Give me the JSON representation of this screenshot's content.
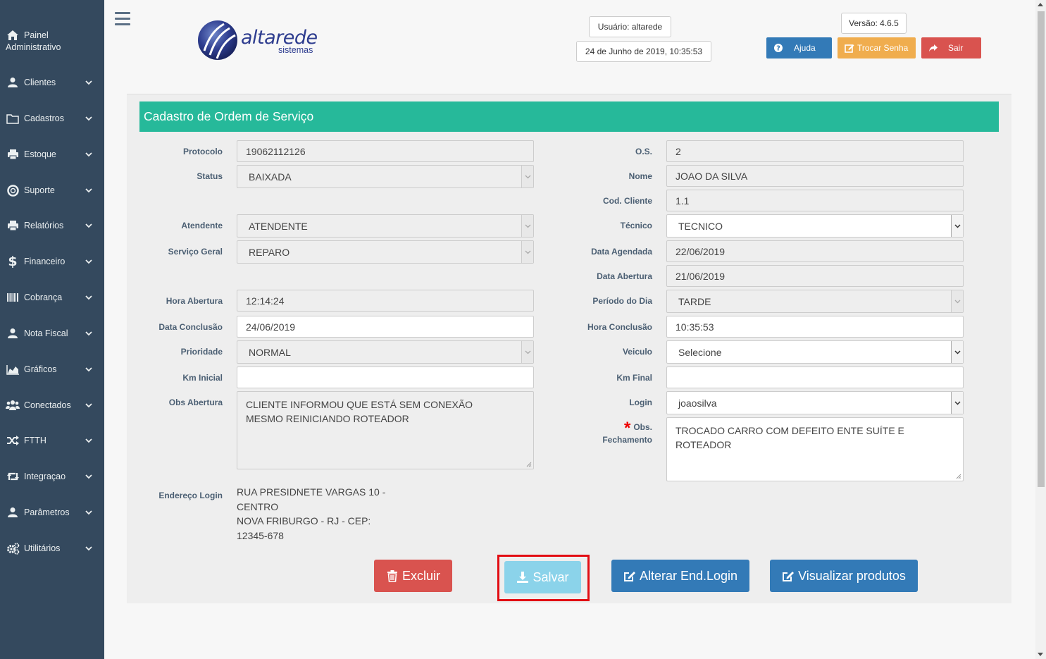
{
  "sidebar": {
    "home_line1": "Painel",
    "home_line2": "Administrativo",
    "items": [
      {
        "label": "Clientes",
        "icon": "user-icon"
      },
      {
        "label": "Cadastros",
        "icon": "folder-icon"
      },
      {
        "label": "Estoque",
        "icon": "print-icon"
      },
      {
        "label": "Suporte",
        "icon": "life-ring-icon"
      },
      {
        "label": "Relatórios",
        "icon": "print-icon"
      },
      {
        "label": "Financeiro",
        "icon": "dollar-icon"
      },
      {
        "label": "Cobrança",
        "icon": "barcode-icon"
      },
      {
        "label": "Nota Fiscal",
        "icon": "user-icon"
      },
      {
        "label": "Gráficos",
        "icon": "area-chart-icon"
      },
      {
        "label": "Conectados",
        "icon": "users-icon"
      },
      {
        "label": "FTTH",
        "icon": "random-icon"
      },
      {
        "label": "Integraçao",
        "icon": "retweet-icon"
      },
      {
        "label": "Parâmetros",
        "icon": "user-icon"
      },
      {
        "label": "Utilitários",
        "icon": "cogs-icon"
      }
    ]
  },
  "header": {
    "logo_brand": "altarede",
    "logo_sub": "sistemas",
    "user": "Usuário: altarede",
    "datetime": "24 de Junho de 2019, 10:35:53",
    "version": "Versão: 4.6.5",
    "help_label": "Ajuda",
    "change_password_label": "Trocar Senha",
    "logout_label": "Sair"
  },
  "form": {
    "title": "Cadastro de Ordem de Serviço",
    "left": {
      "protocolo": {
        "label": "Protocolo",
        "value": "19062112126"
      },
      "status": {
        "label": "Status",
        "value": "BAIXADA"
      },
      "atendente": {
        "label": "Atendente",
        "value": "ATENDENTE"
      },
      "servico_geral": {
        "label": "Serviço Geral",
        "value": "REPARO"
      },
      "hora_abertura": {
        "label": "Hora Abertura",
        "value": "12:14:24"
      },
      "data_conclusao": {
        "label": "Data Conclusão",
        "value": "24/06/2019"
      },
      "prioridade": {
        "label": "Prioridade",
        "value": "NORMAL"
      },
      "km_inicial": {
        "label": "Km Inicial",
        "value": ""
      },
      "obs_abertura": {
        "label": "Obs Abertura",
        "line1": "CLIENTE INFORMOU QUE ESTÁ SEM CONEXÃO",
        "line2": "MESMO REINICIANDO ROTEADOR"
      },
      "endereco_login": {
        "label": "Endereço Login",
        "line1": "RUA PRESIDNETE VARGAS 10 -",
        "line2": "CENTRO",
        "line3": "NOVA FRIBURGO - RJ - CEP:",
        "line4": "12345-678"
      }
    },
    "right": {
      "os": {
        "label": "O.S.",
        "value": "2"
      },
      "nome": {
        "label": "Nome",
        "value": "JOAO DA SILVA"
      },
      "cod_cliente": {
        "label": "Cod. Cliente",
        "value": "1.1"
      },
      "tecnico": {
        "label": "Técnico",
        "value": "TECNICO"
      },
      "data_agendada": {
        "label": "Data Agendada",
        "value": "22/06/2019"
      },
      "data_abertura": {
        "label": "Data Abertura",
        "value": "21/06/2019"
      },
      "periodo_dia": {
        "label": "Período do Dia",
        "value": "TARDE"
      },
      "hora_conclusao": {
        "label": "Hora Conclusão",
        "value": "10:35:53"
      },
      "veiculo": {
        "label": "Veiculo",
        "value": "Selecione"
      },
      "km_final": {
        "label": "Km Final",
        "value": ""
      },
      "login": {
        "label": "Login",
        "value": "joaosilva"
      },
      "obs_fechamento": {
        "label_line1": "Obs.",
        "label_line2": "Fechamento",
        "line1": "TROCADO CARRO COM DEFEITO ENTE SUÍTE E",
        "line2": "ROTEADOR"
      }
    }
  },
  "actions": {
    "excluir": "Excluir",
    "salvar": "Salvar",
    "alterar": "Alterar End.Login",
    "visualizar": "Visualizar produtos"
  },
  "colors": {
    "sidebar": "#34495e",
    "title_bar": "#26b99a",
    "primary": "#337ab7",
    "warning": "#f0ad4e",
    "danger": "#d9534f",
    "info": "#5bc0de",
    "highlight": "#e20d13"
  }
}
